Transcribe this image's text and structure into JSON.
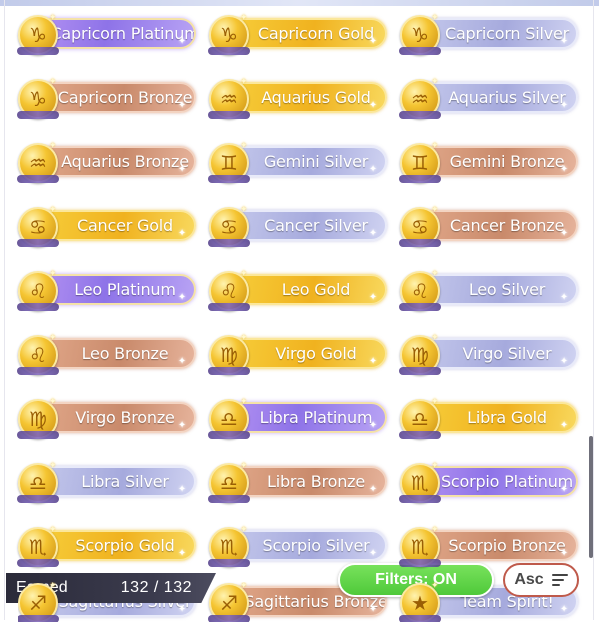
{
  "badges": [
    {
      "label": "Capricorn Platinum",
      "tier": "platinum",
      "icon": "capricorn-icon",
      "glyph": "♑"
    },
    {
      "label": "Capricorn Gold",
      "tier": "gold",
      "icon": "capricorn-icon",
      "glyph": "♑"
    },
    {
      "label": "Capricorn Silver",
      "tier": "silver",
      "icon": "capricorn-icon",
      "glyph": "♑"
    },
    {
      "label": "Capricorn Bronze",
      "tier": "bronze",
      "icon": "capricorn-icon",
      "glyph": "♑"
    },
    {
      "label": "Aquarius Gold",
      "tier": "gold",
      "icon": "aquarius-icon",
      "glyph": "♒"
    },
    {
      "label": "Aquarius Silver",
      "tier": "silver",
      "icon": "aquarius-icon",
      "glyph": "♒"
    },
    {
      "label": "Aquarius Bronze",
      "tier": "bronze",
      "icon": "aquarius-icon",
      "glyph": "♒"
    },
    {
      "label": "Gemini Silver",
      "tier": "silver",
      "icon": "gemini-icon",
      "glyph": "♊"
    },
    {
      "label": "Gemini Bronze",
      "tier": "bronze",
      "icon": "gemini-icon",
      "glyph": "♊"
    },
    {
      "label": "Cancer Gold",
      "tier": "gold",
      "icon": "cancer-icon",
      "glyph": "♋"
    },
    {
      "label": "Cancer Silver",
      "tier": "silver",
      "icon": "cancer-icon",
      "glyph": "♋"
    },
    {
      "label": "Cancer Bronze",
      "tier": "bronze",
      "icon": "cancer-icon",
      "glyph": "♋"
    },
    {
      "label": "Leo Platinum",
      "tier": "platinum",
      "icon": "leo-icon",
      "glyph": "♌"
    },
    {
      "label": "Leo Gold",
      "tier": "gold",
      "icon": "leo-icon",
      "glyph": "♌"
    },
    {
      "label": "Leo Silver",
      "tier": "silver",
      "icon": "leo-icon",
      "glyph": "♌"
    },
    {
      "label": "Leo Bronze",
      "tier": "bronze",
      "icon": "leo-icon",
      "glyph": "♌"
    },
    {
      "label": "Virgo Gold",
      "tier": "gold",
      "icon": "virgo-icon",
      "glyph": "♍"
    },
    {
      "label": "Virgo Silver",
      "tier": "silver",
      "icon": "virgo-icon",
      "glyph": "♍"
    },
    {
      "label": "Virgo Bronze",
      "tier": "bronze",
      "icon": "virgo-icon",
      "glyph": "♍"
    },
    {
      "label": "Libra Platinum",
      "tier": "platinum",
      "icon": "libra-icon",
      "glyph": "♎"
    },
    {
      "label": "Libra Gold",
      "tier": "gold",
      "icon": "libra-icon",
      "glyph": "♎"
    },
    {
      "label": "Libra Silver",
      "tier": "silver",
      "icon": "libra-icon",
      "glyph": "♎"
    },
    {
      "label": "Libra Bronze",
      "tier": "bronze",
      "icon": "libra-icon",
      "glyph": "♎"
    },
    {
      "label": "Scorpio Platinum",
      "tier": "platinum",
      "icon": "scorpio-icon",
      "glyph": "♏"
    },
    {
      "label": "Scorpio Gold",
      "tier": "gold",
      "icon": "scorpio-icon",
      "glyph": "♏"
    },
    {
      "label": "Scorpio Silver",
      "tier": "silver",
      "icon": "scorpio-icon",
      "glyph": "♏"
    },
    {
      "label": "Scorpio Bronze",
      "tier": "bronze",
      "icon": "scorpio-icon",
      "glyph": "♏"
    }
  ],
  "partial_badges": [
    {
      "label": "Sagittarius Silver",
      "tier": "silver",
      "icon": "sagittarius-icon",
      "glyph": "♐"
    },
    {
      "label": "Sagittarius Bronze",
      "tier": "bronze",
      "icon": "sagittarius-icon",
      "glyph": "♐"
    },
    {
      "label": "Team Spirit!",
      "tier": "silver",
      "icon": "team-spirit-icon",
      "glyph": "★"
    }
  ],
  "footer": {
    "earned_label": "Earned",
    "earned_value": "132 / 132",
    "filters_label": "Filters: ON",
    "sort_label": "Asc"
  },
  "colors": {
    "platinum": "#9d7fee",
    "gold": "#f2b822",
    "silver": "#aeb2e2",
    "bronze": "#cf9273",
    "filters_button": "#5ccf44",
    "sort_border": "#bf5a4b"
  }
}
